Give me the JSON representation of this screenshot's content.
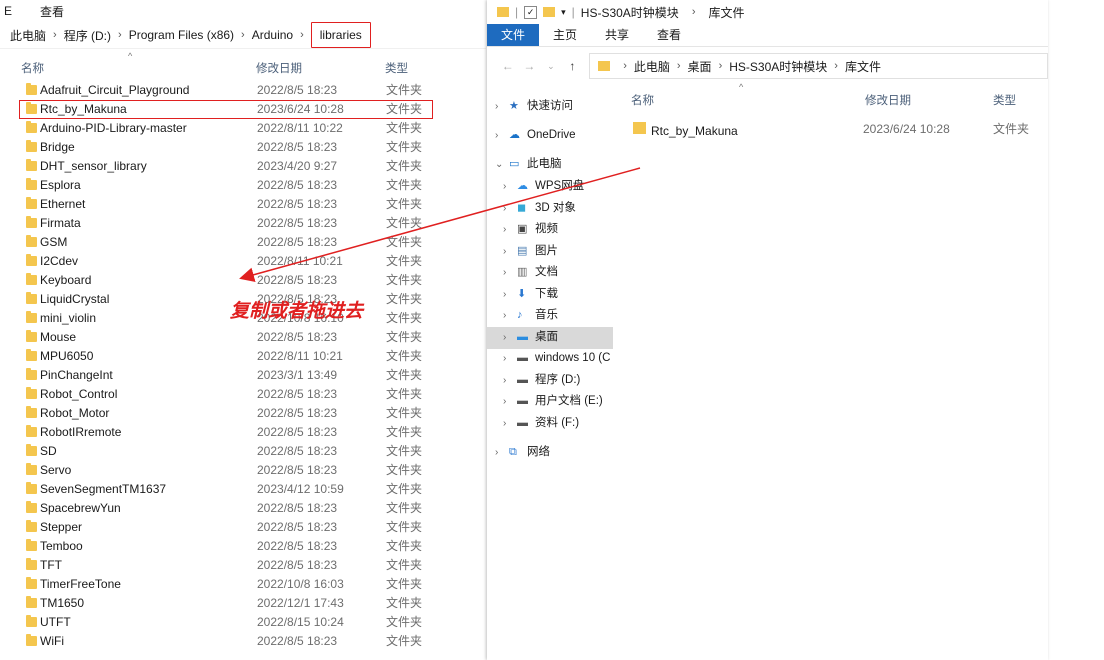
{
  "left": {
    "menu": {
      "edit_label": "E",
      "view_label": "查看"
    },
    "address": {
      "items": [
        "此电脑",
        "程序 (D:)",
        "Program Files (x86)",
        "Arduino",
        "libraries"
      ]
    },
    "columns": {
      "name": "名称",
      "date": "修改日期",
      "type": "类型"
    },
    "files": [
      {
        "name": "Adafruit_Circuit_Playground",
        "date": "2022/8/5 18:23",
        "type": "文件夹"
      },
      {
        "name": "Rtc_by_Makuna",
        "date": "2023/6/24 10:28",
        "type": "文件夹"
      },
      {
        "name": "Arduino-PID-Library-master",
        "date": "2022/8/11 10:22",
        "type": "文件夹"
      },
      {
        "name": "Bridge",
        "date": "2022/8/5 18:23",
        "type": "文件夹"
      },
      {
        "name": "DHT_sensor_library",
        "date": "2023/4/20 9:27",
        "type": "文件夹"
      },
      {
        "name": "Esplora",
        "date": "2022/8/5 18:23",
        "type": "文件夹"
      },
      {
        "name": "Ethernet",
        "date": "2022/8/5 18:23",
        "type": "文件夹"
      },
      {
        "name": "Firmata",
        "date": "2022/8/5 18:23",
        "type": "文件夹"
      },
      {
        "name": "GSM",
        "date": "2022/8/5 18:23",
        "type": "文件夹"
      },
      {
        "name": "I2Cdev",
        "date": "2022/8/11 10:21",
        "type": "文件夹"
      },
      {
        "name": "Keyboard",
        "date": "2022/8/5 18:23",
        "type": "文件夹"
      },
      {
        "name": "LiquidCrystal",
        "date": "2022/8/5 18:23",
        "type": "文件夹"
      },
      {
        "name": "mini_violin",
        "date": "2022/10/8 16:10",
        "type": "文件夹"
      },
      {
        "name": "Mouse",
        "date": "2022/8/5 18:23",
        "type": "文件夹"
      },
      {
        "name": "MPU6050",
        "date": "2022/8/11 10:21",
        "type": "文件夹"
      },
      {
        "name": "PinChangeInt",
        "date": "2023/3/1 13:49",
        "type": "文件夹"
      },
      {
        "name": "Robot_Control",
        "date": "2022/8/5 18:23",
        "type": "文件夹"
      },
      {
        "name": "Robot_Motor",
        "date": "2022/8/5 18:23",
        "type": "文件夹"
      },
      {
        "name": "RobotIRremote",
        "date": "2022/8/5 18:23",
        "type": "文件夹"
      },
      {
        "name": "SD",
        "date": "2022/8/5 18:23",
        "type": "文件夹"
      },
      {
        "name": "Servo",
        "date": "2022/8/5 18:23",
        "type": "文件夹"
      },
      {
        "name": "SevenSegmentTM1637",
        "date": "2023/4/12 10:59",
        "type": "文件夹"
      },
      {
        "name": "SpacebrewYun",
        "date": "2022/8/5 18:23",
        "type": "文件夹"
      },
      {
        "name": "Stepper",
        "date": "2022/8/5 18:23",
        "type": "文件夹"
      },
      {
        "name": "Temboo",
        "date": "2022/8/5 18:23",
        "type": "文件夹"
      },
      {
        "name": "TFT",
        "date": "2022/8/5 18:23",
        "type": "文件夹"
      },
      {
        "name": "TimerFreeTone",
        "date": "2022/10/8 16:03",
        "type": "文件夹"
      },
      {
        "name": "TM1650",
        "date": "2022/12/1 17:43",
        "type": "文件夹"
      },
      {
        "name": "UTFT",
        "date": "2022/8/15 10:24",
        "type": "文件夹"
      },
      {
        "name": "WiFi",
        "date": "2022/8/5 18:23",
        "type": "文件夹"
      }
    ]
  },
  "right": {
    "title": {
      "crumb1": "HS-S30A时钟模块",
      "crumb2": "库文件"
    },
    "ribbon": {
      "file": "文件",
      "home": "主页",
      "share": "共享",
      "view": "查看"
    },
    "address": {
      "items": [
        "此电脑",
        "桌面",
        "HS-S30A时钟模块",
        "库文件"
      ]
    },
    "nav_tree": [
      {
        "label": "快速访问",
        "icon": "star-icon"
      },
      {
        "label": "OneDrive",
        "icon": "cloud-icon"
      },
      {
        "label": "此电脑",
        "icon": "computer-icon"
      },
      {
        "label": "WPS网盘",
        "icon": "wps-cloud-icon"
      },
      {
        "label": "3D 对象",
        "icon": "cube-icon"
      },
      {
        "label": "视频",
        "icon": "video-icon"
      },
      {
        "label": "图片",
        "icon": "picture-icon"
      },
      {
        "label": "文档",
        "icon": "document-icon"
      },
      {
        "label": "下载",
        "icon": "download-icon"
      },
      {
        "label": "音乐",
        "icon": "music-icon"
      },
      {
        "label": "桌面",
        "icon": "desktop-icon"
      },
      {
        "label": "windows 10 (C",
        "icon": "drive-icon"
      },
      {
        "label": "程序 (D:)",
        "icon": "drive-icon"
      },
      {
        "label": "用户文档 (E:)",
        "icon": "drive-icon"
      },
      {
        "label": "资料 (F:)",
        "icon": "drive-icon"
      },
      {
        "label": "网络",
        "icon": "network-icon"
      }
    ],
    "columns": {
      "name": "名称",
      "date": "修改日期",
      "type": "类型"
    },
    "files": [
      {
        "name": "Rtc_by_Makuna",
        "date": "2023/6/24 10:28",
        "type": "文件夹"
      }
    ]
  },
  "annotation": {
    "text": "复制或者拖进去",
    "color": "#e02020"
  }
}
